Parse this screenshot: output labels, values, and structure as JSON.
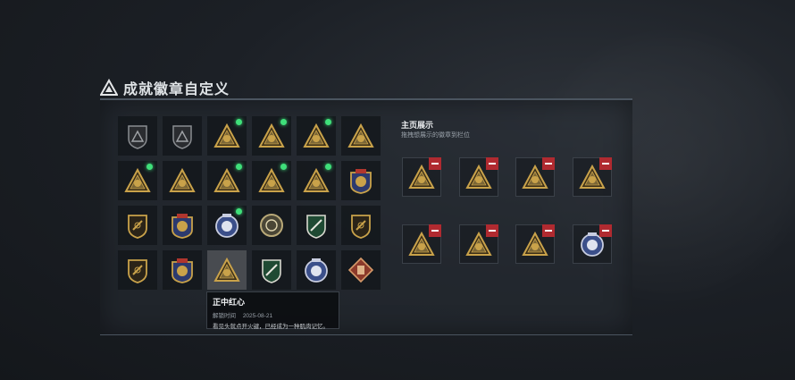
{
  "header": {
    "title": "成就徽章自定义",
    "icon": "triangle-logo-icon"
  },
  "colors": {
    "gold": "#c9a24a",
    "blue": "#3b4f8a",
    "green": "#2f7d4b",
    "new_dot": "#3fe07a",
    "remove": "#b02a30"
  },
  "grid": {
    "rows": [
      [
        {
          "icon": "triangle-shield-icon",
          "style": "dark",
          "new": false
        },
        {
          "icon": "helicopter-shield-icon",
          "style": "dark",
          "new": false
        },
        {
          "icon": "skull-triangle-icon",
          "style": "gold",
          "new": true
        },
        {
          "icon": "soldier-58-triangle-icon",
          "style": "gold",
          "new": true
        },
        {
          "icon": "backpack-triangle-icon",
          "style": "gold",
          "new": true
        },
        {
          "icon": "door-triangle-icon",
          "style": "gold",
          "new": false
        }
      ],
      [
        {
          "icon": "helmet-triangle-icon",
          "style": "gold",
          "new": true
        },
        {
          "icon": "number-one-triangle-icon",
          "style": "gold",
          "new": false
        },
        {
          "icon": "squad-triangle-icon",
          "style": "gold",
          "new": true
        },
        {
          "icon": "eagle-triangle-icon",
          "style": "gold",
          "new": true
        },
        {
          "icon": "soldiers-triangle-icon",
          "style": "gold",
          "new": true
        },
        {
          "icon": "star-medal-icon",
          "style": "medal",
          "new": false
        }
      ],
      [
        {
          "icon": "medic-shield-icon",
          "style": "gold-shield",
          "new": false
        },
        {
          "icon": "crest-medal-icon",
          "style": "medal",
          "new": false
        },
        {
          "icon": "police-badge-icon",
          "style": "blue",
          "new": true
        },
        {
          "icon": "gun-coin-icon",
          "style": "coin",
          "new": false
        },
        {
          "icon": "green-rifle-shield-icon",
          "style": "green",
          "new": false
        },
        {
          "icon": "rifle-shield-icon",
          "style": "gold-shield",
          "new": false
        }
      ],
      [
        {
          "icon": "knife-shield-icon",
          "style": "gold-shield",
          "new": false
        },
        {
          "icon": "anchor-crest-icon",
          "style": "medal",
          "new": false
        },
        {
          "icon": "target-diamond-icon",
          "style": "selected",
          "new": false
        },
        {
          "icon": "wings-hexagon-icon",
          "style": "green",
          "new": false
        },
        {
          "icon": "rider-coin-icon",
          "style": "blue",
          "new": false
        },
        {
          "icon": "armor-diamond-icon",
          "style": "red",
          "new": false
        }
      ]
    ]
  },
  "showcase": {
    "title": "主页展示",
    "subtitle": "拖拽想展示的徽章到栏位",
    "slots": [
      {
        "icon": "backpack-triangle-icon",
        "style": "gold"
      },
      {
        "icon": "soldier-58-triangle-icon",
        "style": "gold"
      },
      {
        "icon": "skull-triangle-icon",
        "style": "gold"
      },
      {
        "icon": "eagle-triangle-icon",
        "style": "gold"
      },
      {
        "icon": "helmet-triangle-icon",
        "style": "gold"
      },
      {
        "icon": "soldiers-triangle-icon",
        "style": "gold"
      },
      {
        "icon": "squad-triangle-icon",
        "style": "gold"
      },
      {
        "icon": "police-badge-icon",
        "style": "blue"
      }
    ]
  },
  "tooltip": {
    "name": "正中红心",
    "unlock_label": "解锁时间",
    "unlock_date": "2025-08-21",
    "description": "看见头就点开火键，已经成为一种肌肉记忆。"
  }
}
